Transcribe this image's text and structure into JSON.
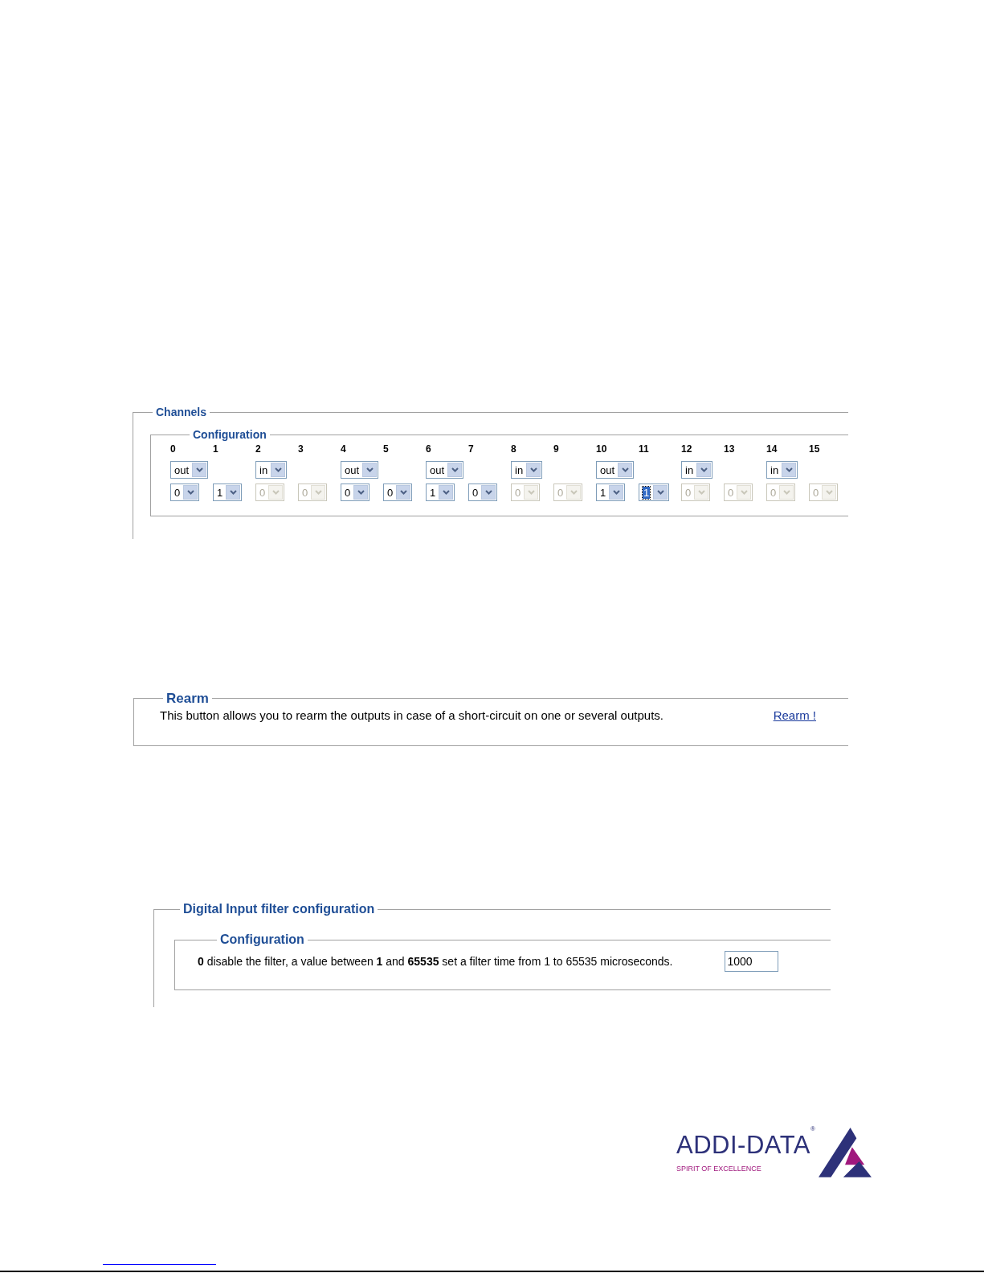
{
  "channels_panel": {
    "title": "Channels",
    "configuration": {
      "title": "Configuration",
      "channels": [
        {
          "label": "0",
          "direction": "out",
          "value": "0",
          "disabled": false,
          "highlighted": false
        },
        {
          "label": "1",
          "value": "1",
          "disabled": false,
          "highlighted": false
        },
        {
          "label": "2",
          "direction": "in",
          "value": "0",
          "disabled": true,
          "highlighted": false
        },
        {
          "label": "3",
          "value": "0",
          "disabled": true,
          "highlighted": false
        },
        {
          "label": "4",
          "direction": "out",
          "value": "0",
          "disabled": false,
          "highlighted": false
        },
        {
          "label": "5",
          "value": "0",
          "disabled": false,
          "highlighted": false
        },
        {
          "label": "6",
          "direction": "out",
          "value": "1",
          "disabled": false,
          "highlighted": false
        },
        {
          "label": "7",
          "value": "0",
          "disabled": false,
          "highlighted": false
        },
        {
          "label": "8",
          "direction": "in",
          "value": "0",
          "disabled": true,
          "highlighted": false
        },
        {
          "label": "9",
          "value": "0",
          "disabled": true,
          "highlighted": false
        },
        {
          "label": "10",
          "direction": "out",
          "value": "1",
          "disabled": false,
          "highlighted": false
        },
        {
          "label": "11",
          "value": "1",
          "disabled": false,
          "highlighted": true
        },
        {
          "label": "12",
          "direction": "in",
          "value": "0",
          "disabled": true,
          "highlighted": false
        },
        {
          "label": "13",
          "value": "0",
          "disabled": true,
          "highlighted": false
        },
        {
          "label": "14",
          "direction": "in",
          "value": "0",
          "disabled": true,
          "highlighted": false
        },
        {
          "label": "15",
          "value": "0",
          "disabled": true,
          "highlighted": false
        }
      ]
    }
  },
  "rearm_panel": {
    "title": "Rearm",
    "text": "This button allows you to rearm the outputs in case of a short-circuit on one or several outputs.",
    "link": "Rearm !"
  },
  "filter_panel": {
    "title": "Digital Input filter configuration",
    "configuration": {
      "title": "Configuration",
      "text": "**0** disable the filter, a value between **1** and **65535** set a filter time from 1 to 65535 microseconds.",
      "value": "1000"
    }
  },
  "logo": {
    "name": "ADDI-DATA",
    "mark": "®",
    "tagline": "SPIRIT OF EXCELLENCE"
  }
}
